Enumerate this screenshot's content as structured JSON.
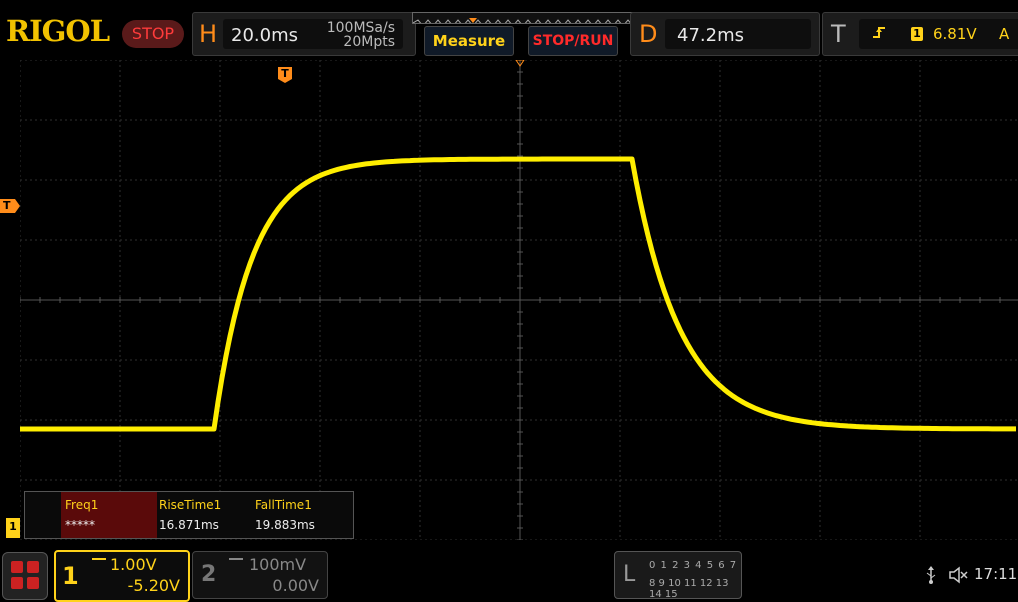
{
  "brand": {
    "logo": "RIGOL",
    "run_state": "STOP"
  },
  "horizontal": {
    "letter": "H",
    "timebase": "20.0ms",
    "sample_rate": "100MSa/s",
    "memory_depth": "20Mpts"
  },
  "buttons": {
    "measure": "Measure",
    "stop_run": "STOP/RUN"
  },
  "delay": {
    "letter": "D",
    "value": "47.2ms"
  },
  "trigger": {
    "letter": "T",
    "slope_icon": "rising-edge-icon",
    "source": "1",
    "level": "6.81V",
    "mode": "A"
  },
  "markers": {
    "trigger_time": "T",
    "trigger_level": "T",
    "ch1": "1"
  },
  "measurements": {
    "headers": [
      "Freq1",
      "RiseTime1",
      "FallTime1"
    ],
    "values": [
      "*****",
      "16.871ms",
      "19.883ms"
    ]
  },
  "ch1": {
    "number": "1",
    "scale": "1.00V",
    "offset": "-5.20V",
    "color": "#ffd21a"
  },
  "ch2": {
    "number": "2",
    "scale": "100mV",
    "offset": "0.00V",
    "color": "#888888"
  },
  "logic_analyzer": {
    "letter": "L",
    "row1": "0 1 2 3   4 5 6 7",
    "row2": "8 9 10 11 12 13 14 15"
  },
  "status": {
    "usb_icon": "usb-icon",
    "mute_icon": "speaker-muted-icon",
    "time": "17:11"
  },
  "colors": {
    "trace": "#ffee00",
    "accent": "#ff8c1a",
    "stop": "#ff3b3b"
  }
}
